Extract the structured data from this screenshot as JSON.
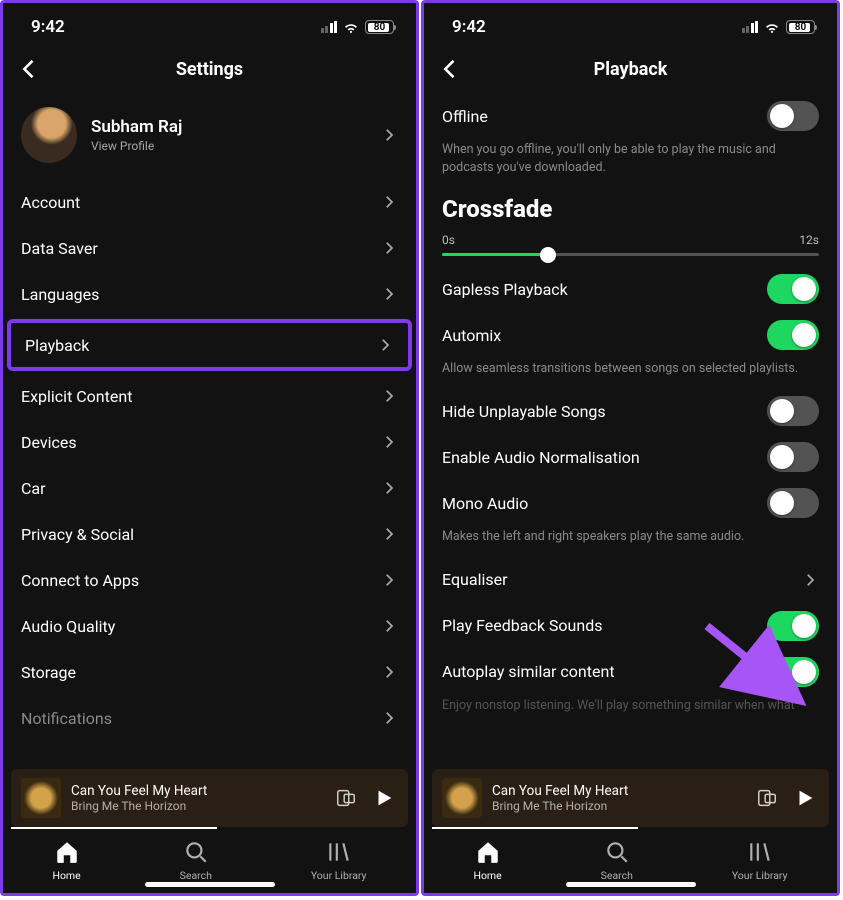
{
  "status": {
    "time": "9:42",
    "battery": "80"
  },
  "left": {
    "title": "Settings",
    "profile": {
      "name": "Subham Raj",
      "sub": "View Profile"
    },
    "rows": [
      {
        "label": "Account"
      },
      {
        "label": "Data Saver"
      },
      {
        "label": "Languages"
      },
      {
        "label": "Playback",
        "highlight": true
      },
      {
        "label": "Explicit Content"
      },
      {
        "label": "Devices"
      },
      {
        "label": "Car"
      },
      {
        "label": "Privacy & Social"
      },
      {
        "label": "Connect to Apps"
      },
      {
        "label": "Audio Quality"
      },
      {
        "label": "Storage"
      },
      {
        "label": "Notifications",
        "faded": true
      }
    ]
  },
  "right": {
    "title": "Playback",
    "offline": {
      "label": "Offline",
      "desc": "When you go offline, you'll only be able to play the music and podcasts you've downloaded."
    },
    "crossfade": {
      "title": "Crossfade",
      "min": "0s",
      "max": "12s"
    },
    "toggles": {
      "gapless": {
        "label": "Gapless Playback",
        "on": true
      },
      "automix": {
        "label": "Automix",
        "on": true,
        "desc": "Allow seamless transitions between songs on selected playlists."
      },
      "hide": {
        "label": "Hide Unplayable Songs",
        "on": false
      },
      "normalise": {
        "label": "Enable Audio Normalisation",
        "on": false
      },
      "mono": {
        "label": "Mono Audio",
        "on": false,
        "desc": "Makes the left and right speakers play the same audio."
      },
      "equaliser": {
        "label": "Equaliser"
      },
      "feedback": {
        "label": "Play Feedback Sounds",
        "on": true
      },
      "autoplay": {
        "label": "Autoplay similar content",
        "on": true,
        "desc": "Enjoy nonstop listening. We'll play something similar when what"
      }
    }
  },
  "nowplaying": {
    "title": "Can You Feel My Heart",
    "artist": "Bring Me The Horizon"
  },
  "tabs": {
    "home": "Home",
    "search": "Search",
    "library": "Your Library"
  }
}
